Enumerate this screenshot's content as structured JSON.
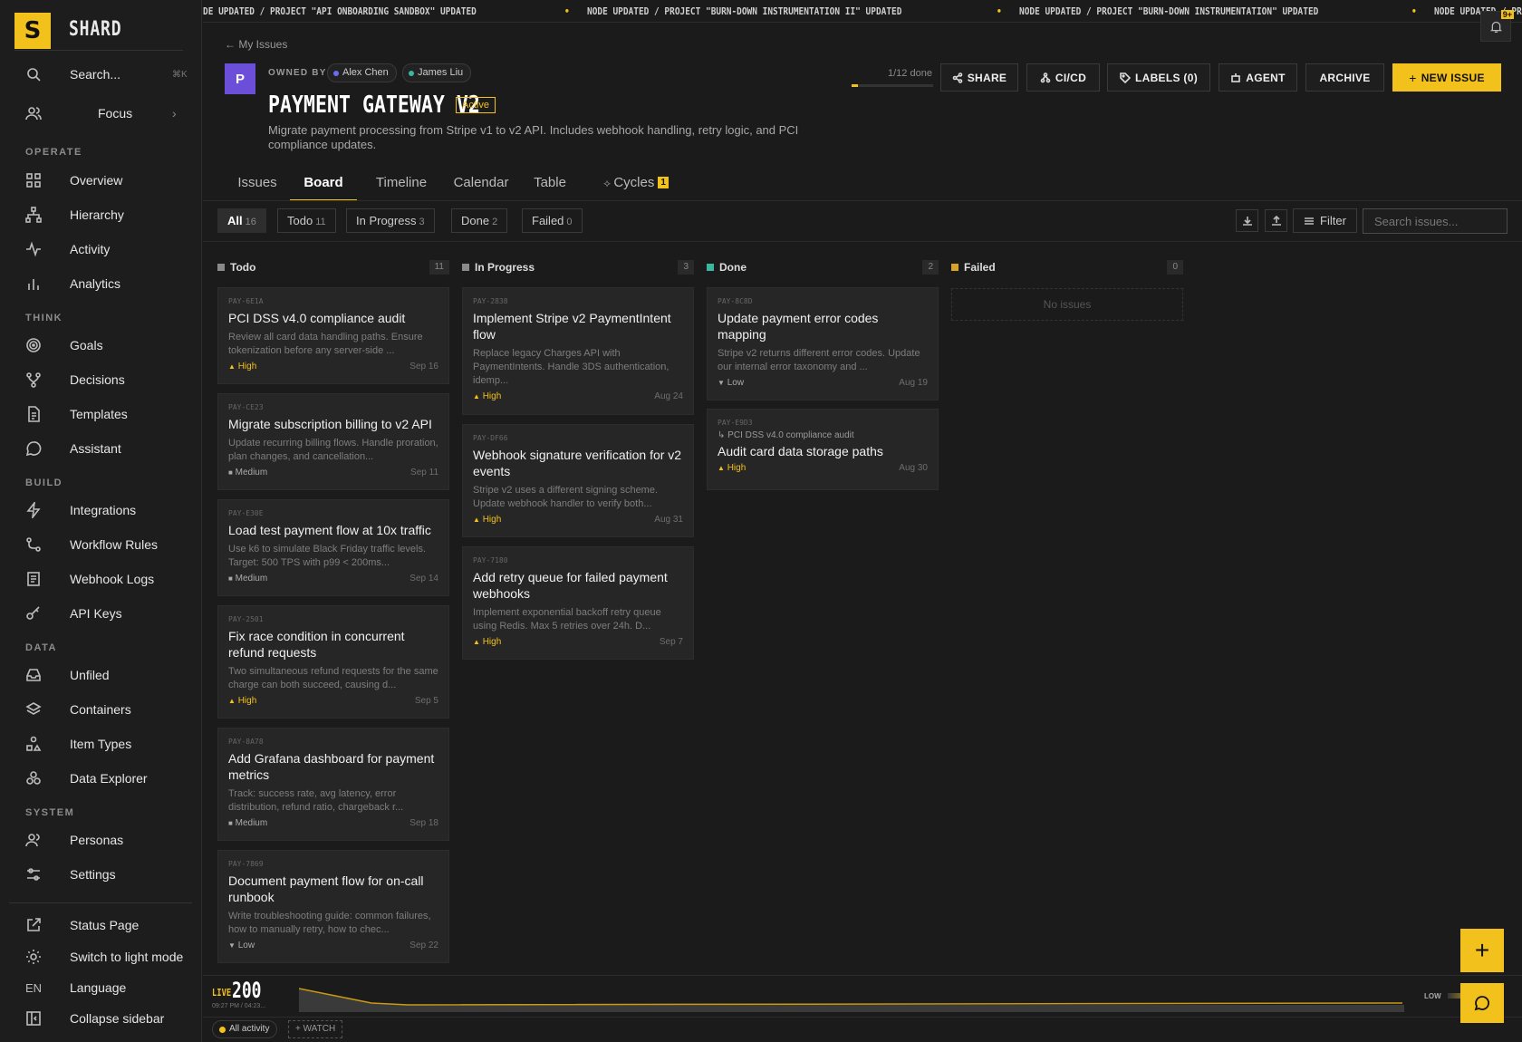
{
  "app": {
    "name": "SHARD",
    "logo_letter": "S"
  },
  "sidebar": {
    "search": {
      "label": "Search...",
      "shortcut": "⌘K"
    },
    "focus": {
      "label": "Focus"
    },
    "sections": {
      "operate": "OPERATE",
      "think": "THINK",
      "build": "BUILD",
      "data": "DATA",
      "system": "SYSTEM"
    },
    "items": {
      "overview": "Overview",
      "hierarchy": "Hierarchy",
      "activity": "Activity",
      "analytics": "Analytics",
      "goals": "Goals",
      "decisions": "Decisions",
      "templates": "Templates",
      "assistant": "Assistant",
      "integrations": "Integrations",
      "workflow_rules": "Workflow Rules",
      "webhook_logs": "Webhook Logs",
      "api_keys": "API Keys",
      "unfiled": "Unfiled",
      "containers": "Containers",
      "item_types": "Item Types",
      "data_explorer": "Data Explorer",
      "personas": "Personas",
      "settings": "Settings"
    },
    "bottom": {
      "status_page": "Status Page",
      "light_mode": "Switch to light mode",
      "language_code": "EN",
      "language": "Language",
      "collapse": "Collapse sidebar"
    }
  },
  "ticker": [
    "DE UPDATED / PROJECT \"API ONBOARDING SANDBOX\" UPDATED",
    "NODE UPDATED / PROJECT \"BURN-DOWN INSTRUMENTATION II\" UPDATED",
    "NODE UPDATED / PROJECT \"BURN-DOWN INSTRUMENTATION\" UPDATED",
    "NODE UPDATED / PROJECT \"SHARE REDACTION AUDIT\" UPDATED"
  ],
  "notifications": {
    "badge": "9+"
  },
  "project": {
    "back_label": "My Issues",
    "avatar_letter": "P",
    "owned_by_label": "OWNED BY",
    "owners": [
      "Alex Chen",
      "James Liu"
    ],
    "title": "PAYMENT GATEWAY V2",
    "status": "Active",
    "description": "Migrate payment processing from Stripe v1 to v2 API. Includes webhook handling, retry logic, and PCI compliance updates.",
    "progress_label": "1/12 done",
    "progress_fraction": 0.083
  },
  "toolbar": {
    "share": "SHARE",
    "cicd": "CI/CD",
    "labels": "LABELS (0)",
    "agent": "AGENT",
    "archive": "ARCHIVE",
    "new_issue": "NEW ISSUE"
  },
  "tabs": {
    "issues": "Issues",
    "board": "Board",
    "timeline": "Timeline",
    "calendar": "Calendar",
    "table": "Table",
    "cycles": "Cycles",
    "cycles_count": "1"
  },
  "filters": {
    "all": {
      "label": "All",
      "count": "16"
    },
    "todo": {
      "label": "Todo",
      "count": "11"
    },
    "in_progress": {
      "label": "In Progress",
      "count": "3"
    },
    "done": {
      "label": "Done",
      "count": "2"
    },
    "failed": {
      "label": "Failed",
      "count": "0"
    },
    "filter_button": "Filter",
    "search_placeholder": "Search issues..."
  },
  "colors": {
    "accent": "#f3c11b",
    "todo": "#8a8a8a",
    "in_progress": "#8a8a8a",
    "done": "#3bb6a0",
    "failed": "#d5a22a"
  },
  "board": {
    "todo": {
      "title": "Todo",
      "count": "11",
      "cards": [
        {
          "id": "PAY-6E1A",
          "title": "PCI DSS v4.0 compliance audit",
          "desc": "Review all card data handling paths. Ensure tokenization before any server-side ...",
          "priority": "High",
          "date": "Sep 16"
        },
        {
          "id": "PAY-CE23",
          "title": "Migrate subscription billing to v2 API",
          "desc": "Update recurring billing flows. Handle proration, plan changes, and cancellation...",
          "priority": "Medium",
          "date": "Sep 11"
        },
        {
          "id": "PAY-E30E",
          "title": "Load test payment flow at 10x traffic",
          "desc": "Use k6 to simulate Black Friday traffic levels. Target: 500 TPS with p99 < 200ms...",
          "priority": "Medium",
          "date": "Sep 14"
        },
        {
          "id": "PAY-2501",
          "title": "Fix race condition in concurrent refund requests",
          "desc": "Two simultaneous refund requests for the same charge can both succeed, causing d...",
          "priority": "High",
          "date": "Sep 5"
        },
        {
          "id": "PAY-8A78",
          "title": "Add Grafana dashboard for payment metrics",
          "desc": "Track: success rate, avg latency, error distribution, refund ratio, chargeback r...",
          "priority": "Medium",
          "date": "Sep 18"
        },
        {
          "id": "PAY-7869",
          "title": "Document payment flow for on-call runbook",
          "desc": "Write troubleshooting guide: common failures, how to manually retry, how to chec...",
          "priority": "Low",
          "date": "Sep 22"
        }
      ]
    },
    "in_progress": {
      "title": "In Progress",
      "count": "3",
      "cards": [
        {
          "id": "PAY-2838",
          "title": "Implement Stripe v2 PaymentIntent flow",
          "desc": "Replace legacy Charges API with PaymentIntents. Handle 3DS authentication, idemp...",
          "priority": "High",
          "date": "Aug 24"
        },
        {
          "id": "PAY-DF66",
          "title": "Webhook signature verification for v2 events",
          "desc": "Stripe v2 uses a different signing scheme. Update webhook handler to verify both...",
          "priority": "High",
          "date": "Aug 31"
        },
        {
          "id": "PAY-7180",
          "title": "Add retry queue for failed payment webhooks",
          "desc": "Implement exponential backoff retry queue using Redis. Max 5 retries over 24h. D...",
          "priority": "High",
          "date": "Sep 7"
        }
      ]
    },
    "done": {
      "title": "Done",
      "count": "2",
      "cards": [
        {
          "id": "PAY-8C8D",
          "title": "Update payment error codes mapping",
          "desc": "Stripe v2 returns different error codes. Update our internal error taxonomy and ...",
          "priority": "Low",
          "date": "Aug 19"
        },
        {
          "id": "PAY-E9D3",
          "parent": "PCI DSS v4.0 compliance audit",
          "title": "Audit card data storage paths",
          "desc": "",
          "priority": "High",
          "date": "Aug 30"
        }
      ]
    },
    "failed": {
      "title": "Failed",
      "count": "0",
      "empty": "No issues"
    }
  },
  "live": {
    "label": "LIVE",
    "value": "200",
    "time_range": "09:27 PM / 04:23...",
    "level_label": "LOW",
    "all_activity": "All activity",
    "watch": "+ WATCH"
  }
}
